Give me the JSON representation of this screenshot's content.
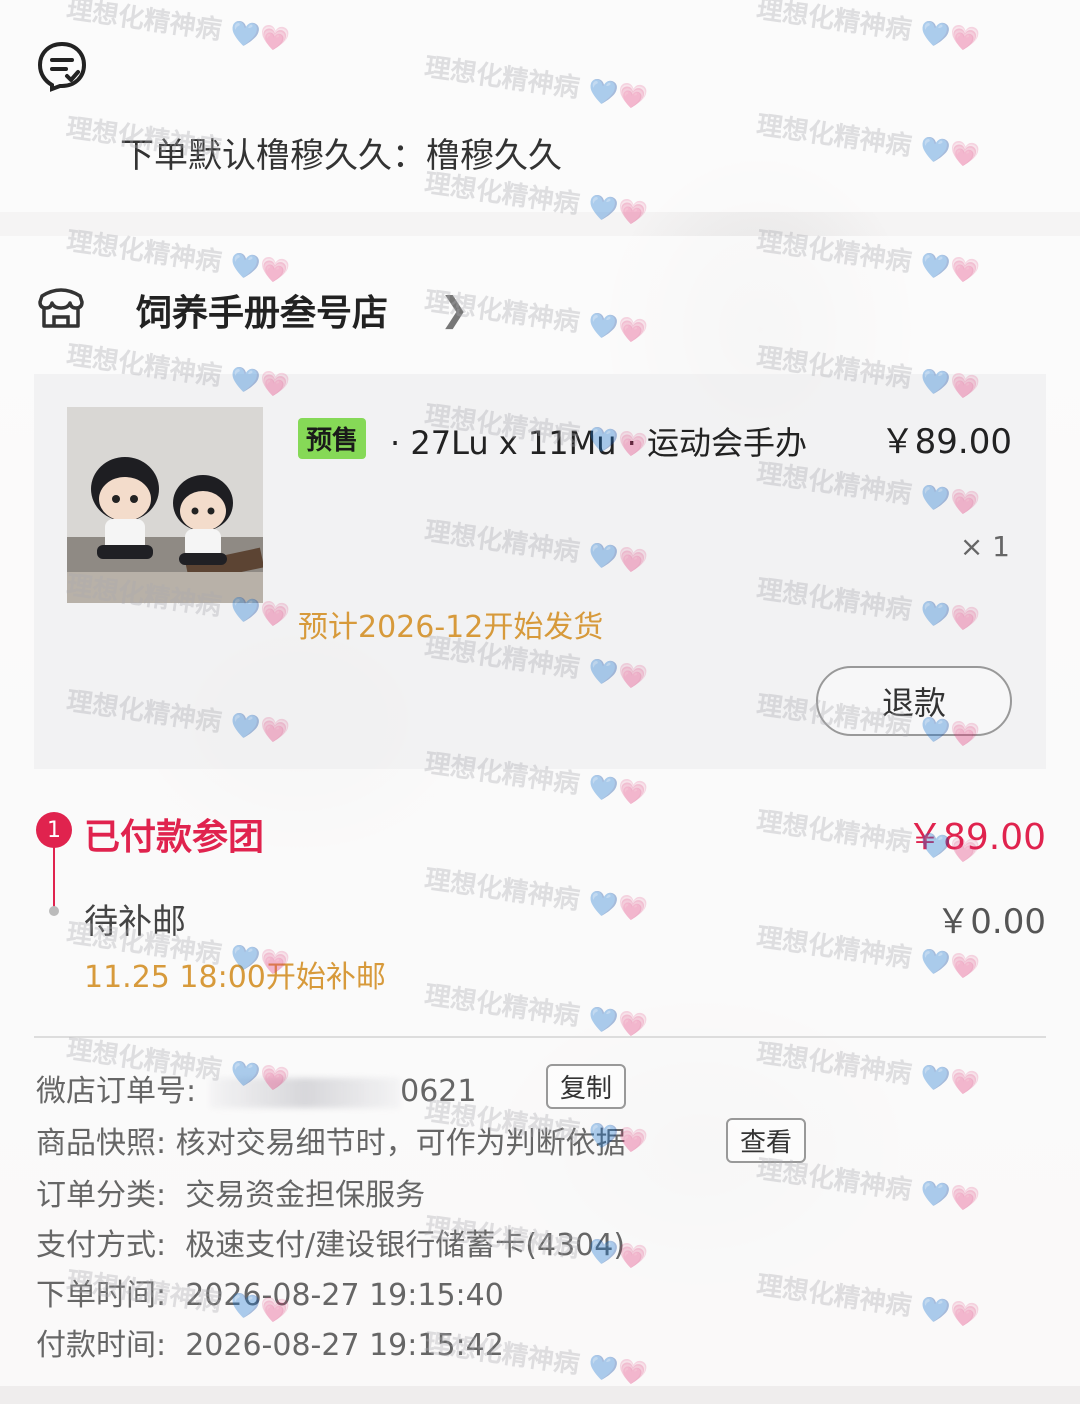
{
  "remark": {
    "text": "下单默认橹穆久久：橹穆久久"
  },
  "shop": {
    "name": "饲养手册叁号店"
  },
  "item": {
    "badge": "预售",
    "title": "· 27Lu x 11Mu · 运动会手办",
    "price": "￥89.00",
    "quantity": "× 1",
    "ship_estimate": "预计2026-12开始发货",
    "refund_label": "退款"
  },
  "payment_steps": {
    "step1_number": "1",
    "step1_label": "已付款参团",
    "step1_amount": "￥89.00",
    "step2_label": "待补邮",
    "step2_amount": "￥0.00",
    "step2_time": "11.25 18:00开始补邮"
  },
  "order_info": {
    "order_no_label": "微店订单号:",
    "order_no_value": "0621",
    "copy_label": "复制",
    "snapshot_label": "商品快照:",
    "snapshot_value": "核对交易细节时，可作为判断依据",
    "view_label": "查看",
    "category_label": "订单分类:",
    "category_value": "交易资金担保服务",
    "pay_method_label": "支付方式:",
    "pay_method_value": "极速支付/建设银行储蓄卡(4304)",
    "order_time_label": "下单时间:",
    "order_time_value": "2026-08-27 19:15:40",
    "pay_time_label": "付款时间:",
    "pay_time_value": "2026-08-27 19:15:42"
  },
  "watermark": {
    "text": "理想化精神病",
    "hearts": "💙💗"
  },
  "colors": {
    "accent": "#e0234e",
    "orange": "#d79a3b",
    "badge_green": "#86d957"
  }
}
